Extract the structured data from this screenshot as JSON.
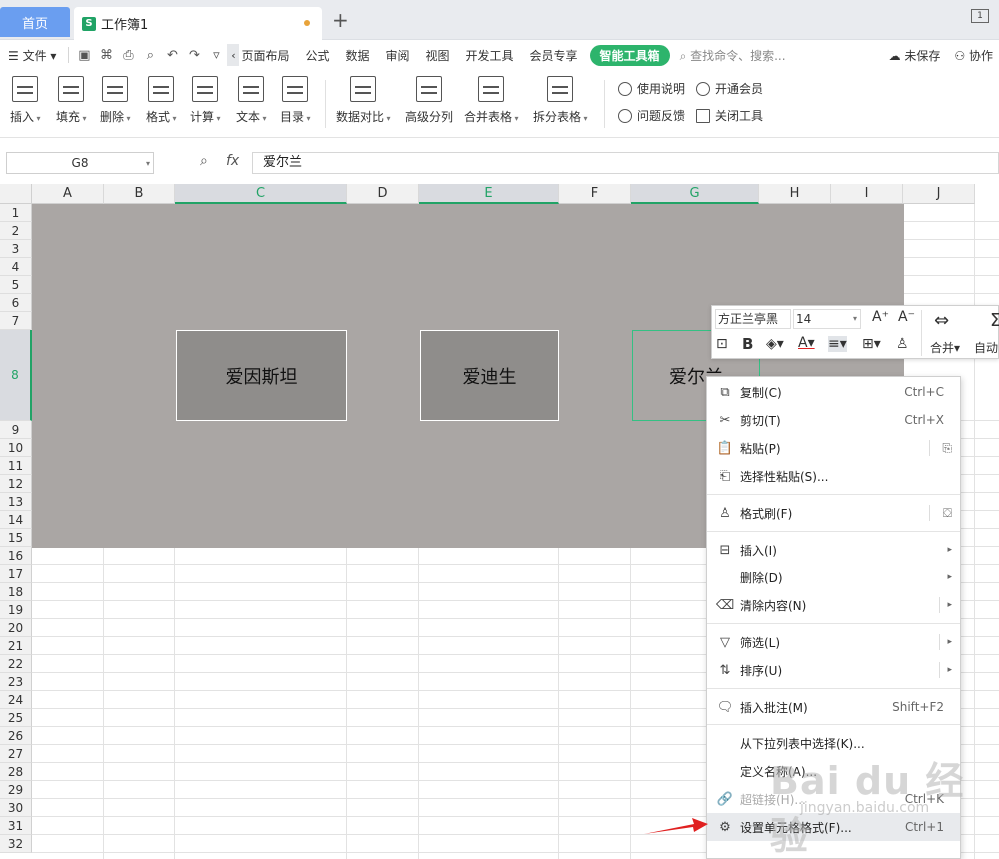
{
  "tabs": {
    "home": "首页",
    "workbook": "工作簿1"
  },
  "window": {
    "badge": "1"
  },
  "menu": {
    "file": "文件",
    "items": [
      "页面布局",
      "公式",
      "数据",
      "审阅",
      "视图",
      "开发工具",
      "会员专享"
    ],
    "smart_tools": "智能工具箱",
    "search_placeholder": "查找命令、搜索...",
    "unsaved": "未保存",
    "collab": "协作"
  },
  "ribbon": {
    "buttons": [
      "插入",
      "填充",
      "删除",
      "格式",
      "计算",
      "文本",
      "目录",
      "数据对比",
      "高级分列",
      "合并表格",
      "拆分表格"
    ],
    "side": [
      "使用说明",
      "开通会员",
      "问题反馈",
      "关闭工具"
    ]
  },
  "formula_bar": {
    "cell_ref": "G8",
    "fx": "fx",
    "value": "爱尔兰"
  },
  "columns": [
    "A",
    "B",
    "C",
    "D",
    "E",
    "F",
    "G",
    "H",
    "I",
    "J"
  ],
  "rows": [
    "1",
    "2",
    "3",
    "4",
    "5",
    "6",
    "7",
    "8",
    "9",
    "10",
    "11",
    "12",
    "13",
    "14",
    "15",
    "16",
    "17",
    "18",
    "19",
    "20",
    "21",
    "22",
    "23",
    "24",
    "25",
    "26",
    "27",
    "28",
    "29",
    "30",
    "31",
    "32"
  ],
  "cells": {
    "c8": "爱因斯坦",
    "e8": "爱迪生",
    "g8": "爱尔兰"
  },
  "mini_toolbar": {
    "font": "方正兰亭黑",
    "size": "14",
    "merge": "合并",
    "auto": "自动"
  },
  "context_menu": [
    {
      "label": "复制(C)",
      "shortcut": "Ctrl+C"
    },
    {
      "label": "剪切(T)",
      "shortcut": "Ctrl+X"
    },
    {
      "label": "粘贴(P)",
      "shortcut": ""
    },
    {
      "label": "选择性粘贴(S)...",
      "shortcut": ""
    },
    {
      "label": "格式刷(F)",
      "shortcut": ""
    },
    {
      "label": "插入(I)",
      "shortcut": ""
    },
    {
      "label": "删除(D)",
      "shortcut": ""
    },
    {
      "label": "清除内容(N)",
      "shortcut": ""
    },
    {
      "label": "筛选(L)",
      "shortcut": ""
    },
    {
      "label": "排序(U)",
      "shortcut": ""
    },
    {
      "label": "插入批注(M)",
      "shortcut": "Shift+F2"
    },
    {
      "label": "从下拉列表中选择(K)...",
      "shortcut": ""
    },
    {
      "label": "定义名称(A)...",
      "shortcut": ""
    },
    {
      "label": "超链接(H)...",
      "shortcut": "Ctrl+K"
    },
    {
      "label": "设置单元格格式(F)...",
      "shortcut": "Ctrl+1"
    }
  ],
  "watermark": {
    "brand": "Bai du 经验",
    "url": "jingyan.baidu.com"
  },
  "colors": {
    "accent": "#21a366",
    "tab_home": "#6a9ef0",
    "smart": "#2db46c",
    "sheet_bg": "#aaa6a4",
    "arrow": "#e02020"
  }
}
